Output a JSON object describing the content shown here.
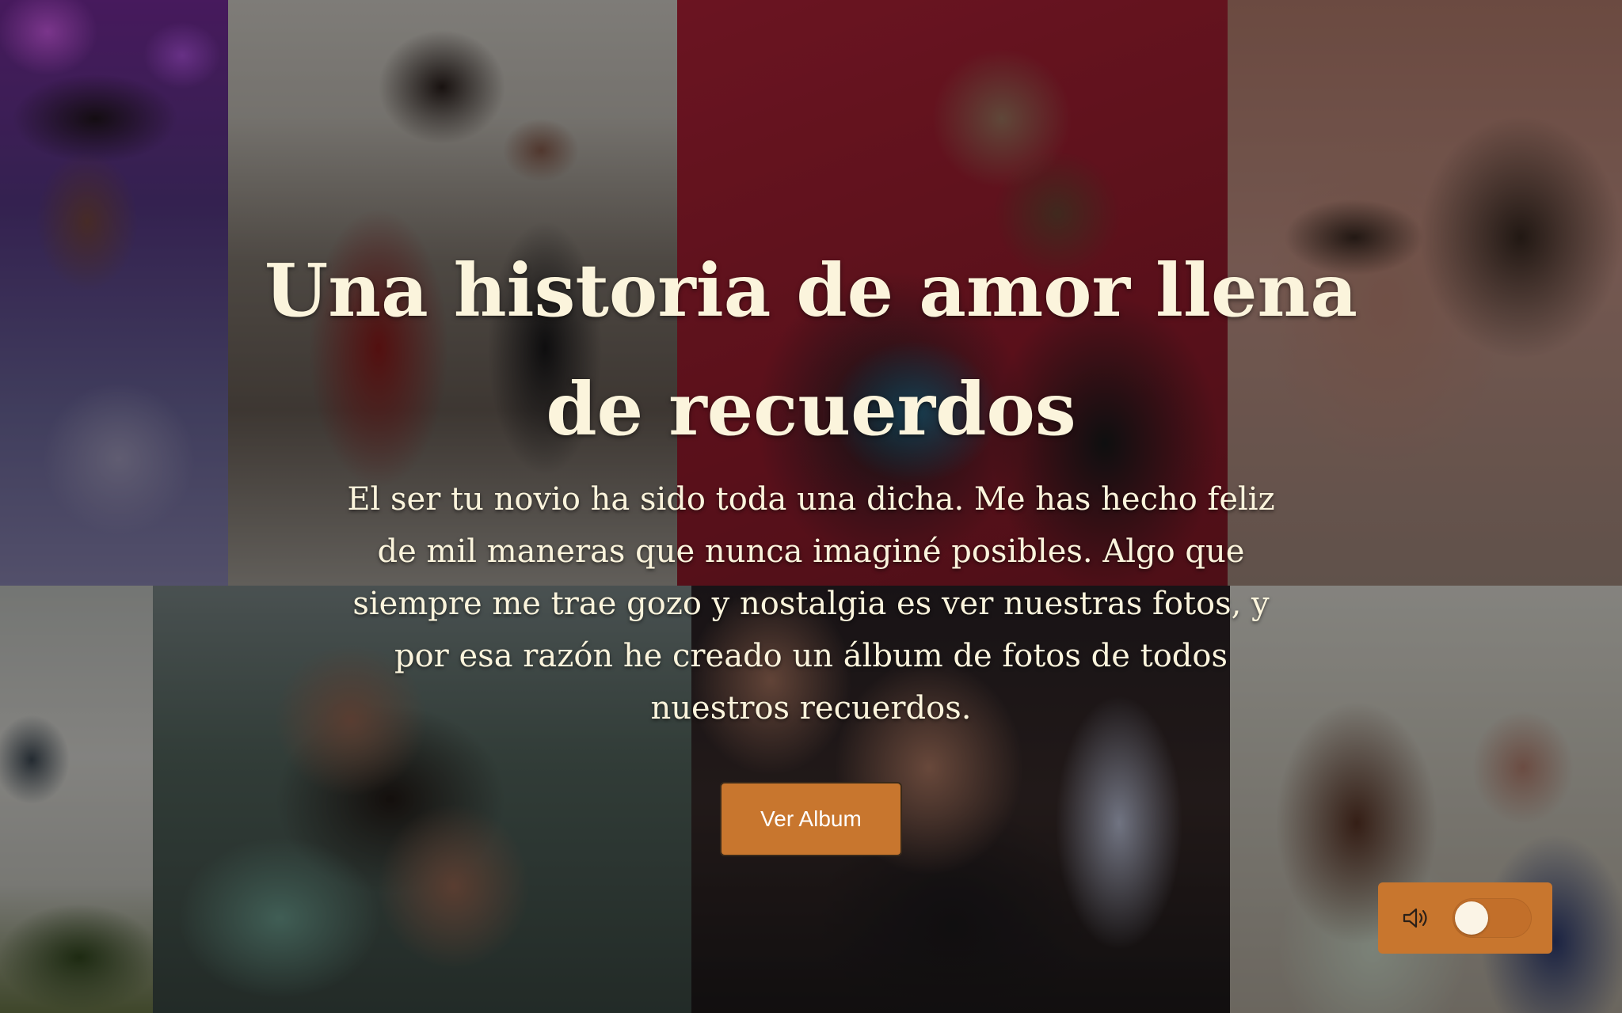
{
  "hero": {
    "title": "Una historia de amor llena de recuerdos",
    "body": "El ser tu novio ha sido toda una dicha. Me has hecho feliz de mil maneras que nunca imaginé posibles. Algo que siempre me trae gozo y nostalgia es ver nuestras fotos, y por esa razón he creado un álbum de fotos de todos nuestros recuerdos.",
    "cta_label": "Ver Album"
  },
  "audio": {
    "icon": "speaker-icon",
    "toggle_state": "off"
  },
  "colors": {
    "accent": "#c8762e",
    "title_text": "#fbf4dc",
    "toggle_knob": "#fbf4e6"
  }
}
